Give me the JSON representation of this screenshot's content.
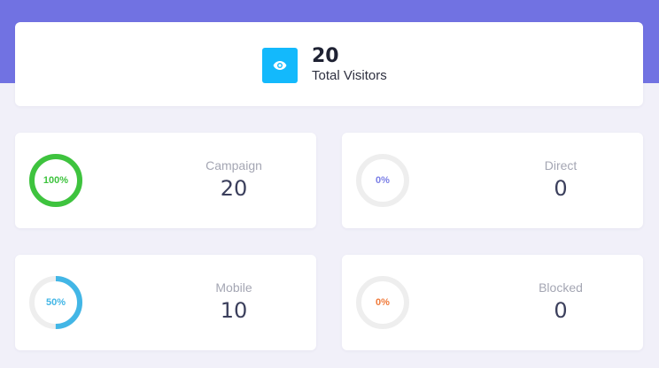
{
  "summary": {
    "icon": "eye-icon",
    "value": "20",
    "label": "Total Visitors",
    "icon_color": "#13b9fc"
  },
  "stats": [
    {
      "key": "campaign",
      "label": "Campaign",
      "value": "20",
      "percent_text": "100%",
      "percent": 100,
      "color": "#3ec33e"
    },
    {
      "key": "direct",
      "label": "Direct",
      "value": "0",
      "percent_text": "0%",
      "percent": 0,
      "color": "#7b7fe6"
    },
    {
      "key": "mobile",
      "label": "Mobile",
      "value": "10",
      "percent_text": "50%",
      "percent": 50,
      "color": "#42b6e6"
    },
    {
      "key": "blocked",
      "label": "Blocked",
      "value": "0",
      "percent_text": "0%",
      "percent": 0,
      "color": "#f07a3a"
    }
  ],
  "colors": {
    "header_band": "#7172e2",
    "background": "#f1f0f9",
    "ring_track": "#eeeeee"
  }
}
